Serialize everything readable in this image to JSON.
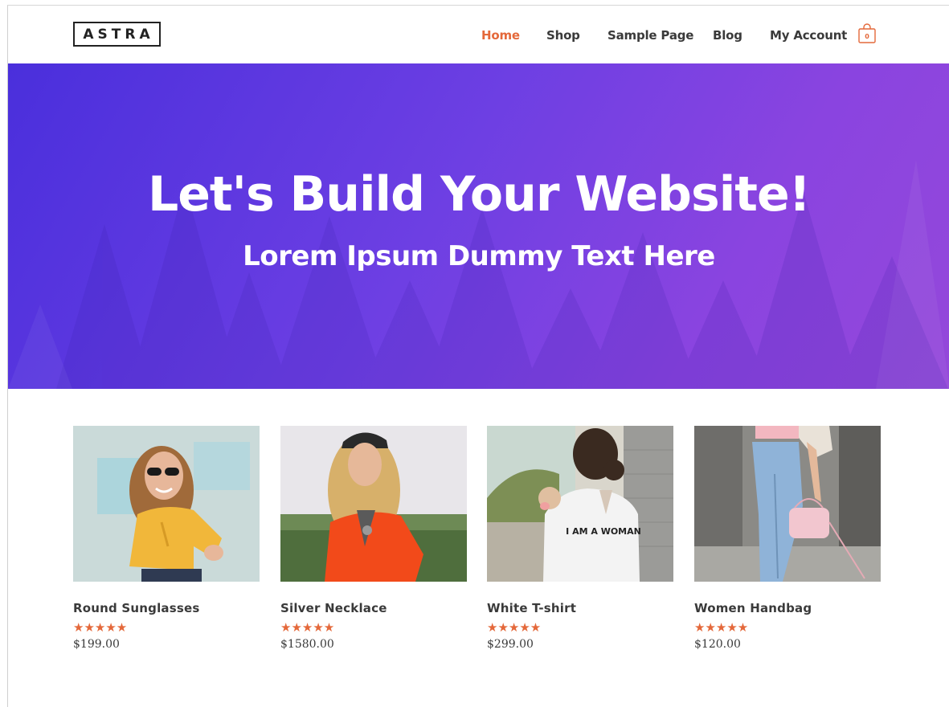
{
  "header": {
    "logo": "ASTRA",
    "nav": [
      {
        "label": "Home",
        "active": true
      },
      {
        "label": "Shop",
        "active": false
      },
      {
        "label": "Sample Page",
        "active": false
      },
      {
        "label": "Blog",
        "active": false
      },
      {
        "label": "My Account",
        "active": false
      }
    ],
    "cart_count": "0"
  },
  "hero": {
    "title": "Let's Build Your Website!",
    "subtitle": "Lorem Ipsum Dummy Text Here"
  },
  "products": [
    {
      "name": "Round Sunglasses",
      "rating": "★★★★★",
      "price": "$199.00"
    },
    {
      "name": "Silver Necklace",
      "rating": "★★★★★",
      "price": "$1580.00"
    },
    {
      "name": "White T-shirt",
      "rating": "★★★★★",
      "price": "$299.00"
    },
    {
      "name": "Women Handbag",
      "rating": "★★★★★",
      "price": "$120.00"
    }
  ],
  "product_images": [
    {
      "label": "woman-yellow-shirt-sunglasses-photo"
    },
    {
      "label": "woman-red-sweater-cap-photo",
      "caption": ""
    },
    {
      "label": "woman-white-tshirt-dog-photo",
      "print": "I AM A WOMAN"
    },
    {
      "label": "woman-jeans-pink-handbag-photo"
    }
  ],
  "colors": {
    "accent": "#e4683a",
    "text": "#3a3a3a",
    "hero_start": "#4a2fdc",
    "hero_end": "#9448da"
  }
}
